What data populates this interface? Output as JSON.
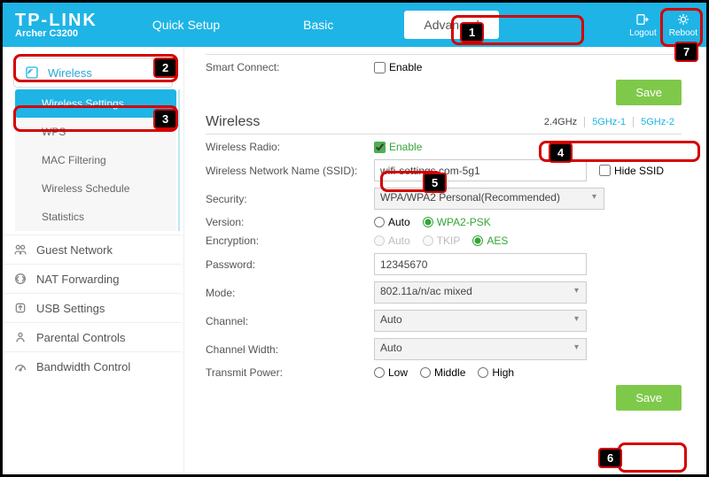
{
  "brand": {
    "logo": "TP-LINK",
    "model": "Archer C3200"
  },
  "header": {
    "tabs": {
      "quick": "Quick Setup",
      "basic": "Basic",
      "advanced": "Advanced"
    },
    "logout": "Logout",
    "reboot": "Reboot"
  },
  "sidebar": {
    "wireless": "Wireless",
    "sub": {
      "wireless_settings": "Wireless Settings",
      "wps": "WPS",
      "mac_filtering": "MAC Filtering",
      "wireless_schedule": "Wireless Schedule",
      "statistics": "Statistics"
    },
    "items": {
      "guest_network": "Guest Network",
      "nat_forwarding": "NAT Forwarding",
      "usb_settings": "USB Settings",
      "parental_controls": "Parental Controls",
      "bandwidth_control": "Bandwidth Control"
    }
  },
  "content": {
    "smart_connect_section": "Smart Connect",
    "smart_connect_label": "Smart Connect:",
    "enable_cb": "Enable",
    "save": "Save",
    "wireless_title": "Wireless",
    "bands": {
      "b24": "2.4GHz",
      "b51": "5GHz-1",
      "b52": "5GHz-2"
    },
    "rows": {
      "radio": "Wireless Radio:",
      "radio_enable": "Enable",
      "ssid": "Wireless Network Name (SSID):",
      "ssid_value": "wifi-settings.com-5g1",
      "hide_ssid": "Hide SSID",
      "security": "Security:",
      "security_value": "WPA/WPA2 Personal(Recommended)",
      "version": "Version:",
      "version_auto": "Auto",
      "version_wpa2": "WPA2-PSK",
      "encryption": "Encryption:",
      "enc_auto": "Auto",
      "enc_tkip": "TKIP",
      "enc_aes": "AES",
      "password": "Password:",
      "password_value": "12345670",
      "mode": "Mode:",
      "mode_value": "802.11a/n/ac mixed",
      "channel": "Channel:",
      "channel_value": "Auto",
      "cwidth": "Channel Width:",
      "cwidth_value": "Auto",
      "tx": "Transmit Power:",
      "tx_low": "Low",
      "tx_mid": "Middle",
      "tx_high": "High"
    }
  },
  "annotations": {
    "n1": "1",
    "n2": "2",
    "n3": "3",
    "n4": "4",
    "n5": "5",
    "n6": "6",
    "n7": "7"
  }
}
